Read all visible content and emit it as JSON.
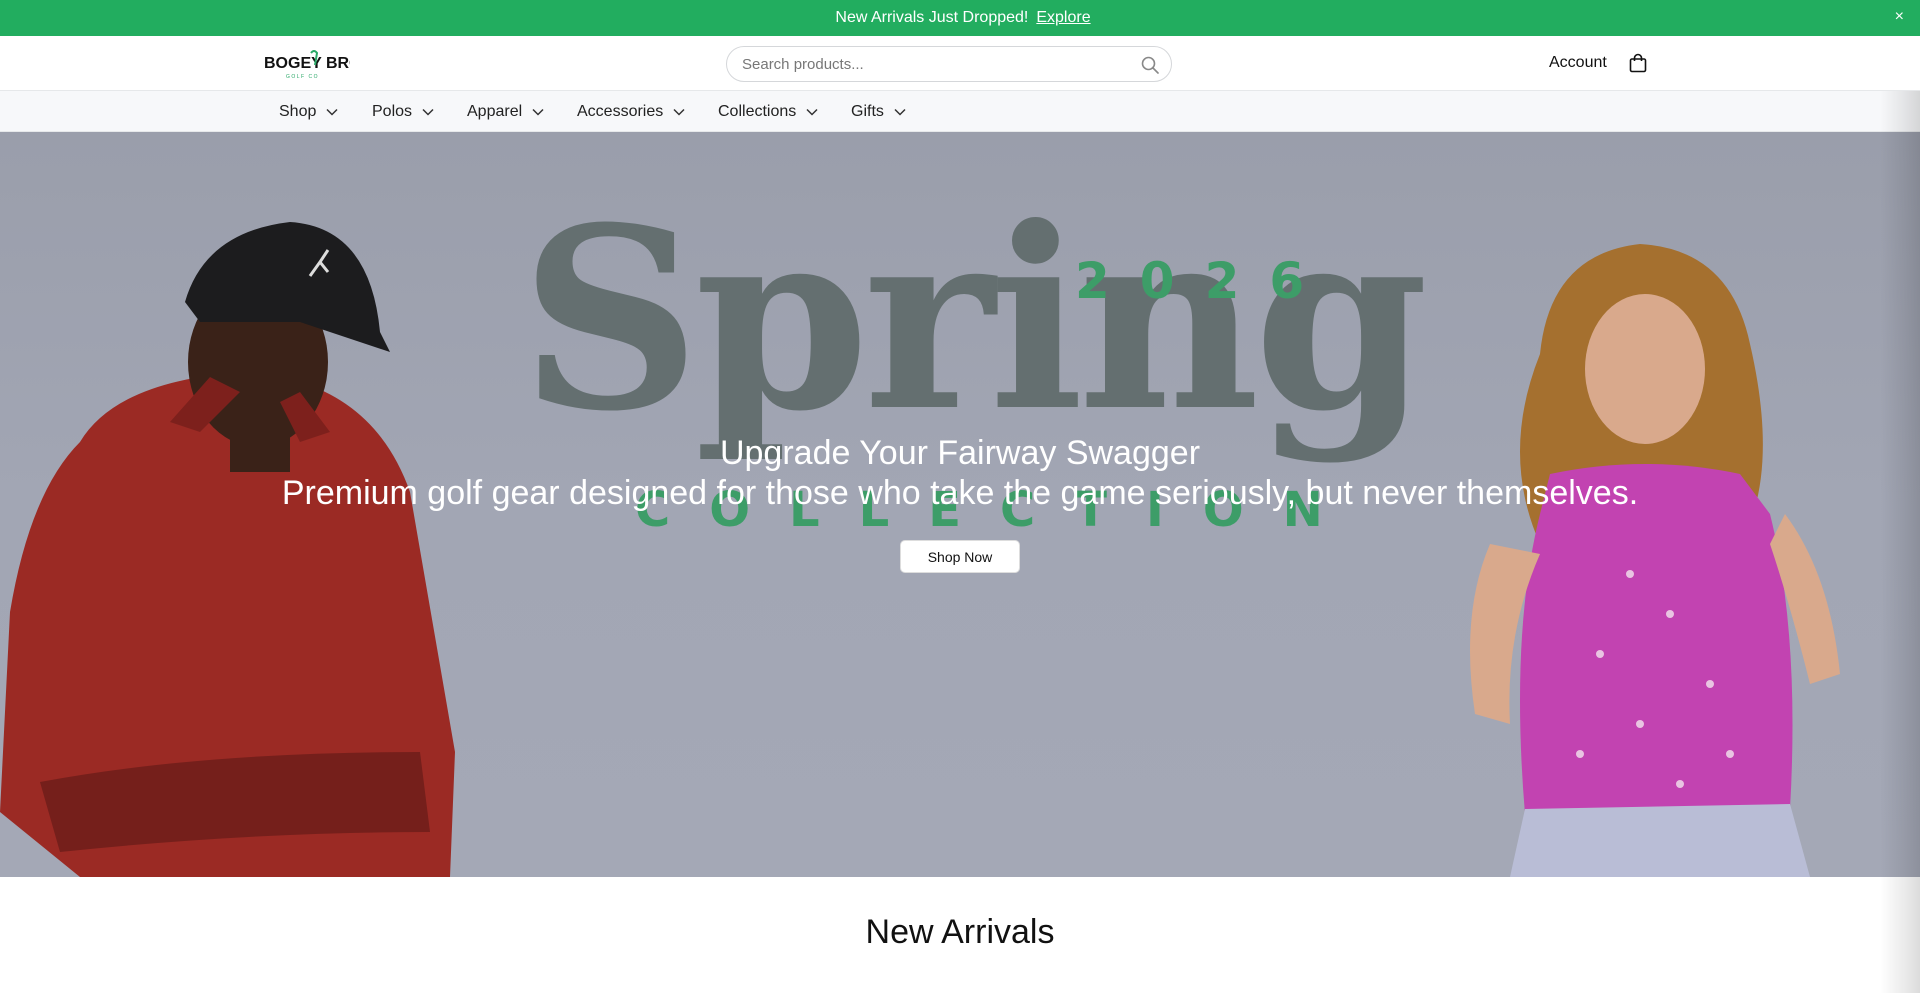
{
  "announcement": {
    "glyph": "",
    "text": "New Arrivals Just Dropped!",
    "link": "Explore",
    "close": "×"
  },
  "header": {
    "logo_text": "BOGEY BROS",
    "logo_subtext": "GOLF CO",
    "search_placeholder": "Search products...",
    "account_label": "Account"
  },
  "nav": {
    "items": [
      {
        "label": "Shop"
      },
      {
        "label": "Polos"
      },
      {
        "label": "Apparel"
      },
      {
        "label": "Accessories"
      },
      {
        "label": "Collections"
      },
      {
        "label": "Gifts"
      }
    ]
  },
  "hero": {
    "graphic_word": "Spring",
    "graphic_year": "2026",
    "graphic_collection": "COLLECTION",
    "title": "Upgrade Your Fairway Swagger",
    "subtitle": "Premium golf gear designed for those who take the game seriously, but never themselves.",
    "cta": "Shop Now"
  },
  "sections": {
    "new_arrivals_title": "New Arrivals"
  },
  "colors": {
    "brand_green": "#22ad5f",
    "hero_bg": "#a2a6b4",
    "spring_text": "#646f70",
    "accent_text": "#3d9d68"
  }
}
